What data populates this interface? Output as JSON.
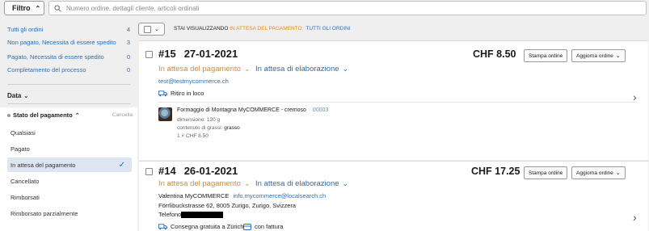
{
  "topbar": {
    "filter_label": "Filtro",
    "search_placeholder": "Numero ordine, dettagli cliente, articoli ordinati"
  },
  "sidebar": {
    "links": [
      {
        "label": "Tutti gli ordini",
        "count": "4"
      },
      {
        "label": "Non pagato, Necessita di essere spedito",
        "count": "3"
      },
      {
        "label": "Pagato, Necessita di essere spedito",
        "count": "0"
      },
      {
        "label": "Completamento del processo",
        "count": "0"
      }
    ],
    "data_label": "Data",
    "payment_panel": {
      "title": "Stato del pagamento",
      "cancel": "Cancella",
      "options": [
        "Qualsiasi",
        "Pagato",
        "In attesa del pagamento",
        "Cancellato",
        "Rimborsati",
        "Rimborsato parzialmente"
      ],
      "selected_index": 2
    }
  },
  "header": {
    "viewing_prefix": "STAI VISUALIZZANDO",
    "viewing_status": "IN ATTESA DEL PAGAMENTO",
    "all_orders": "TUTTI GLI ORDINI"
  },
  "orders": [
    {
      "number": "#15",
      "date": "27-01-2021",
      "payment_status": "In attesa del pagamento",
      "processing_status": "In attesa di elaborazione",
      "email": "test@testmycommerce.ch",
      "delivery": "Ritiro in loco",
      "price": "CHF 8.50",
      "print_label": "Stampa ordine",
      "update_label": "Aggiorna ordine",
      "item": {
        "name": "Formaggio di Montagna MyCOMMERCE - cremoso",
        "sku": "00003",
        "dimension": "dimensione: 120 g",
        "fat_label": "contenuto di grassi:",
        "fat_value": "grasso",
        "qty_price": "1 × CHF 8.50"
      }
    },
    {
      "number": "#14",
      "date": "26-01-2021",
      "payment_status": "In attesa del pagamento",
      "processing_status": "In attesa di elaborazione",
      "customer": "Valentina MyCOMMERCE",
      "email": "info.mycommerce@localsearch.ch",
      "address": "Förrlibuckstrasse 62, 8005 Zurigo, Zurigo, Svizzera",
      "phone_label": "Telefono",
      "shipping": "Consegna gratuita a Zürich",
      "invoice": "con fattura",
      "price": "CHF 17.25",
      "print_label": "Stampa ordine",
      "update_label": "Aggiorna ordine"
    }
  ],
  "colors": {
    "accent_blue": "#2b6fb5",
    "status_orange": "#e28a1e"
  }
}
